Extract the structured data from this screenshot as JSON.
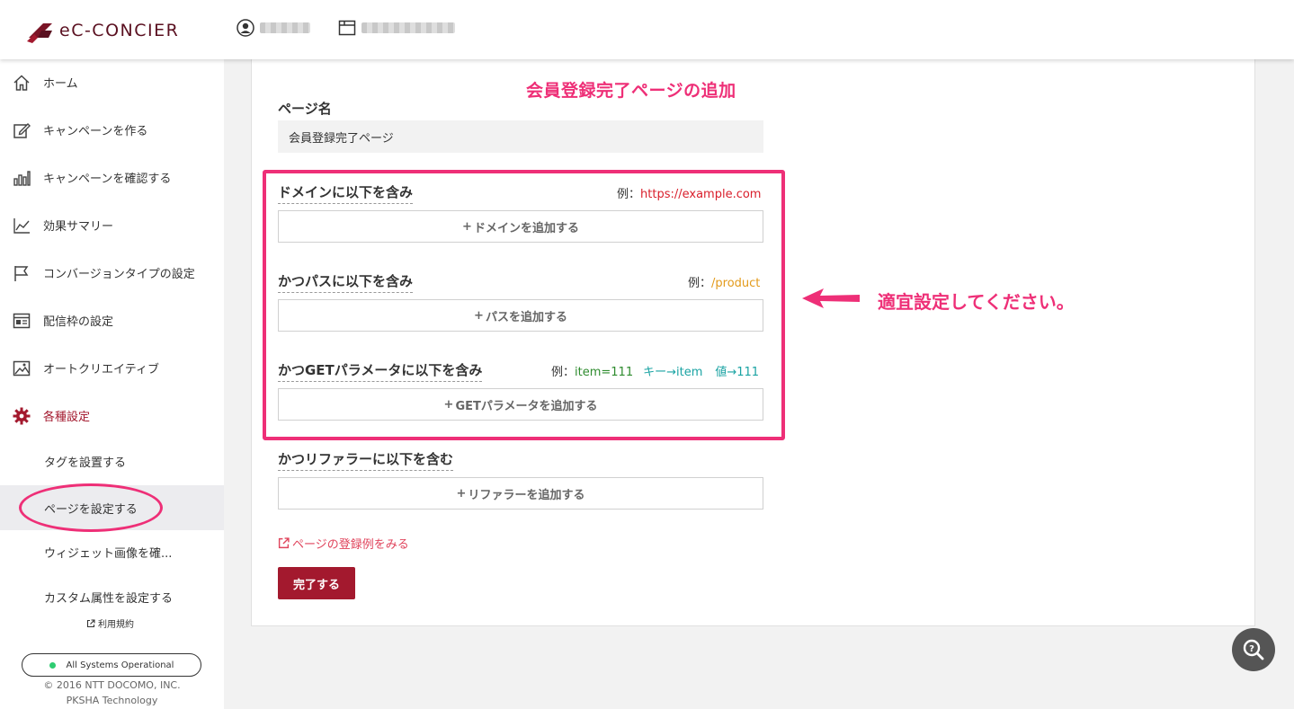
{
  "header": {
    "logo_text": "eC-CONCIER"
  },
  "sidebar": {
    "items": [
      {
        "label": "ホーム",
        "icon": "home-icon"
      },
      {
        "label": "キャンペーンを作る",
        "icon": "edit-icon"
      },
      {
        "label": "キャンペーンを確認する",
        "icon": "bar-chart-icon"
      },
      {
        "label": "効果サマリー",
        "icon": "line-chart-icon"
      },
      {
        "label": "コンバージョンタイプの設定",
        "icon": "flag-icon"
      },
      {
        "label": "配信枠の設定",
        "icon": "window-icon"
      },
      {
        "label": "オートクリエイティブ",
        "icon": "image-icon"
      },
      {
        "label": "各種設定",
        "icon": "gear-icon",
        "active": true
      }
    ],
    "sub_items": [
      {
        "label": "タグを設置する"
      },
      {
        "label": "ページを設定する",
        "selected": true
      },
      {
        "label": "ウィジェット画像を確..."
      },
      {
        "label": "カスタム属性を設定する"
      }
    ],
    "terms": "利用規約",
    "status": "All Systems Operational",
    "copyright_1": "© 2016 NTT DOCOMO, INC.",
    "copyright_2": "PKSHA Technology"
  },
  "main": {
    "annotation_title": "会員登録完了ページの追加",
    "page_name_label": "ページ名",
    "page_name_value": "会員登録完了ページ",
    "domain": {
      "label": "ドメインに以下を含み",
      "example_prefix": "例：",
      "example_value": "https://example.com",
      "add_button": "ドメインを追加する"
    },
    "path": {
      "label": "かつパスに以下を含み",
      "example_prefix": "例：",
      "example_value": "/product",
      "add_button": "パスを追加する"
    },
    "get_param": {
      "label": "かつGETパラメータに以下を含み",
      "example_prefix": "例：",
      "example_value": "item=111",
      "example_key": "キー→item",
      "example_val": "値→111",
      "add_button": "GETパラメータを追加する"
    },
    "referrer": {
      "label": "かつリファラーに以下を含む",
      "add_button": "リファラーを追加する"
    },
    "annotation_side": "適宜設定してください。",
    "example_link": "ページの登録例をみる",
    "done_button": "完了する"
  },
  "colors": {
    "brand": "#a3192e",
    "annotation": "#ee2f77",
    "status_ok": "#2ecc71"
  }
}
